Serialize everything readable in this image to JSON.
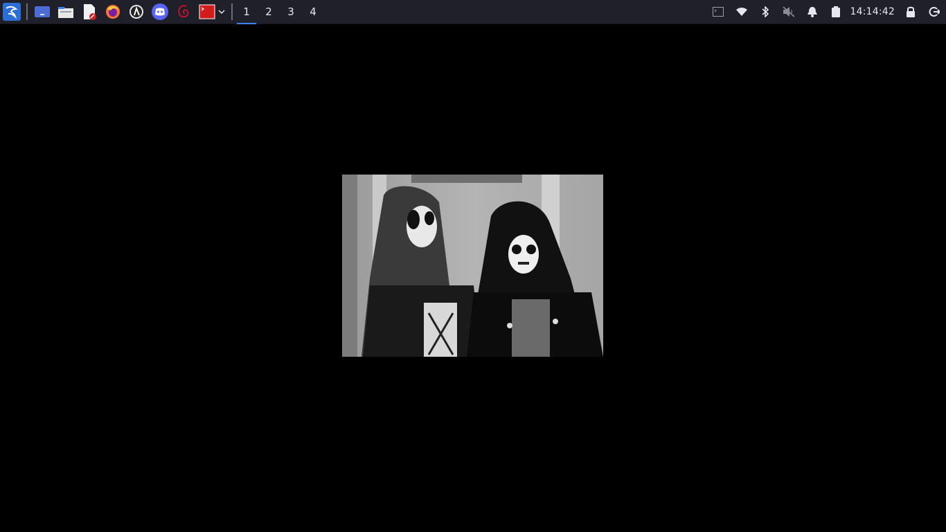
{
  "taskbar": {
    "apps": [
      {
        "name": "workspace-switcher-app"
      },
      {
        "name": "file-manager-app"
      },
      {
        "name": "text-editor-app"
      },
      {
        "name": "firefox-app"
      },
      {
        "name": "steam-app"
      },
      {
        "name": "discord-app"
      },
      {
        "name": "debian-app"
      },
      {
        "name": "terminal-app"
      }
    ],
    "workspaces": [
      "1",
      "2",
      "3",
      "4"
    ],
    "active_workspace": "1",
    "clock": "14:14:42",
    "accent_color": "#3b82f6",
    "background_color": "#1f2029"
  },
  "viewer": {
    "background_color": "#000000",
    "image_description_icon": "photo"
  }
}
